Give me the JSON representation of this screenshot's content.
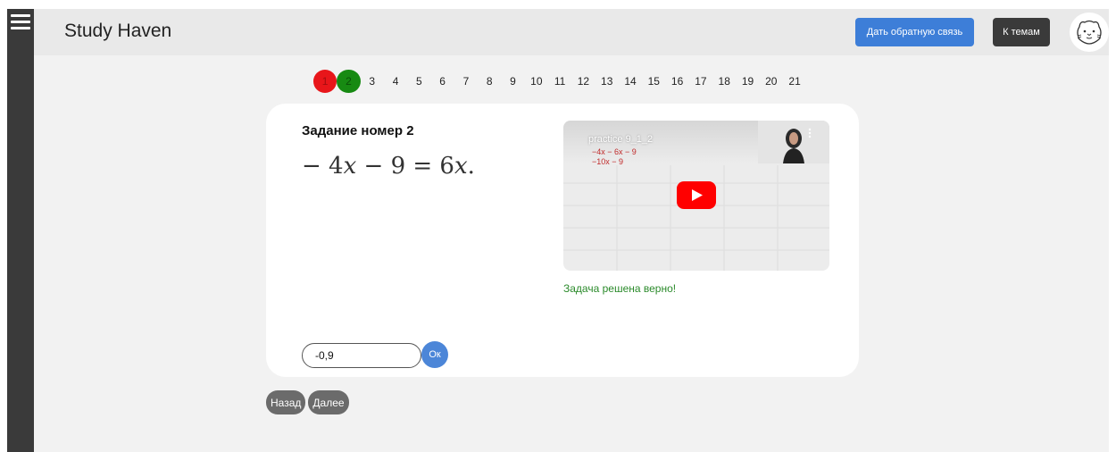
{
  "header": {
    "title": "Study Haven",
    "feedback_label": "Дать обратную связь",
    "topics_label": "К темам"
  },
  "sidebar": {
    "menu_icon": "hamburger-menu-icon"
  },
  "avatar": {
    "icon": "hamster-face-icon"
  },
  "pager": {
    "pages": [
      "1",
      "2",
      "3",
      "4",
      "5",
      "6",
      "7",
      "8",
      "9",
      "10",
      "11",
      "12",
      "13",
      "14",
      "15",
      "16",
      "17",
      "18",
      "19",
      "20",
      "21"
    ],
    "wrong_color": "#e8161a",
    "correct_color": "#178a12"
  },
  "task": {
    "title": "Задание номер 2",
    "equation": {
      "lhs_a": "− 4",
      "lhs_var": "x",
      "lhs_b": " − 9 = 6",
      "rhs_var": "x",
      "end": "."
    }
  },
  "video": {
    "caption": "practice 9_1_2",
    "handwriting": [
      "−4x − 6x − 9",
      "−10x − 9"
    ],
    "play_icon": "youtube-play-icon"
  },
  "result": {
    "text": "Задача решена верно!",
    "color": "#2a8a2a"
  },
  "answer": {
    "value": "-0,9",
    "ok_label": "Ок"
  },
  "nav": {
    "back_label": "Назад",
    "next_label": "Далее"
  },
  "colors": {
    "accent": "#3d7ed8",
    "dark": "#3a3a3a"
  }
}
